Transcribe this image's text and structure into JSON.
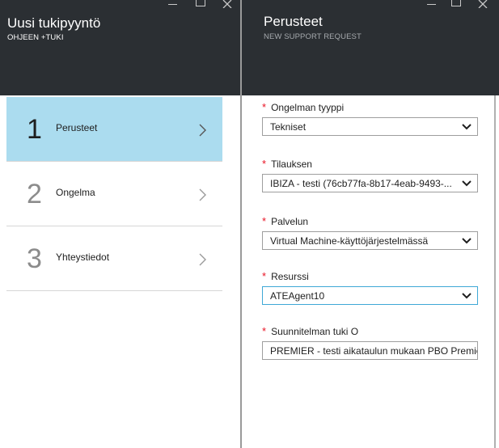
{
  "left_blade": {
    "title": "Uusi tukipyyntö",
    "subtitle": "OHJEEN +TUKI",
    "steps": [
      {
        "number": "1",
        "label": "Perusteet",
        "active": true
      },
      {
        "number": "2",
        "label": "Ongelma",
        "active": false
      },
      {
        "number": "3",
        "label": "Yhteystiedot",
        "active": false
      }
    ]
  },
  "right_blade": {
    "title": "Perusteet",
    "subtitle": "NEW SUPPORT REQUEST",
    "required_marker": "*",
    "fields": [
      {
        "label": "Ongelman tyyppi",
        "value": "Tekniset"
      },
      {
        "label": "Tilauksen",
        "value": "IBIZA - testi (76cb77fa-8b17-4eab-9493-..."
      },
      {
        "label": "Palvelun",
        "value": "Virtual Machine-käyttöjärjestelmässä"
      },
      {
        "label": "Resurssi",
        "value": "ATEAgent10"
      },
      {
        "label": "Suunnitelman tuki O",
        "value": "PREMIER - testi aikataulun mukaan PBO Premier..."
      }
    ]
  },
  "colors": {
    "header_bg": "#2b2f33",
    "active_step_bg": "#abdcef",
    "required": "#e81123",
    "focus_border": "#3fa8d6"
  },
  "icons": {
    "minimize": "minimize-icon",
    "maximize": "maximize-icon",
    "close": "close-icon",
    "step_arrow": "chevron-right-icon",
    "dropdown": "chevron-down-icon"
  }
}
